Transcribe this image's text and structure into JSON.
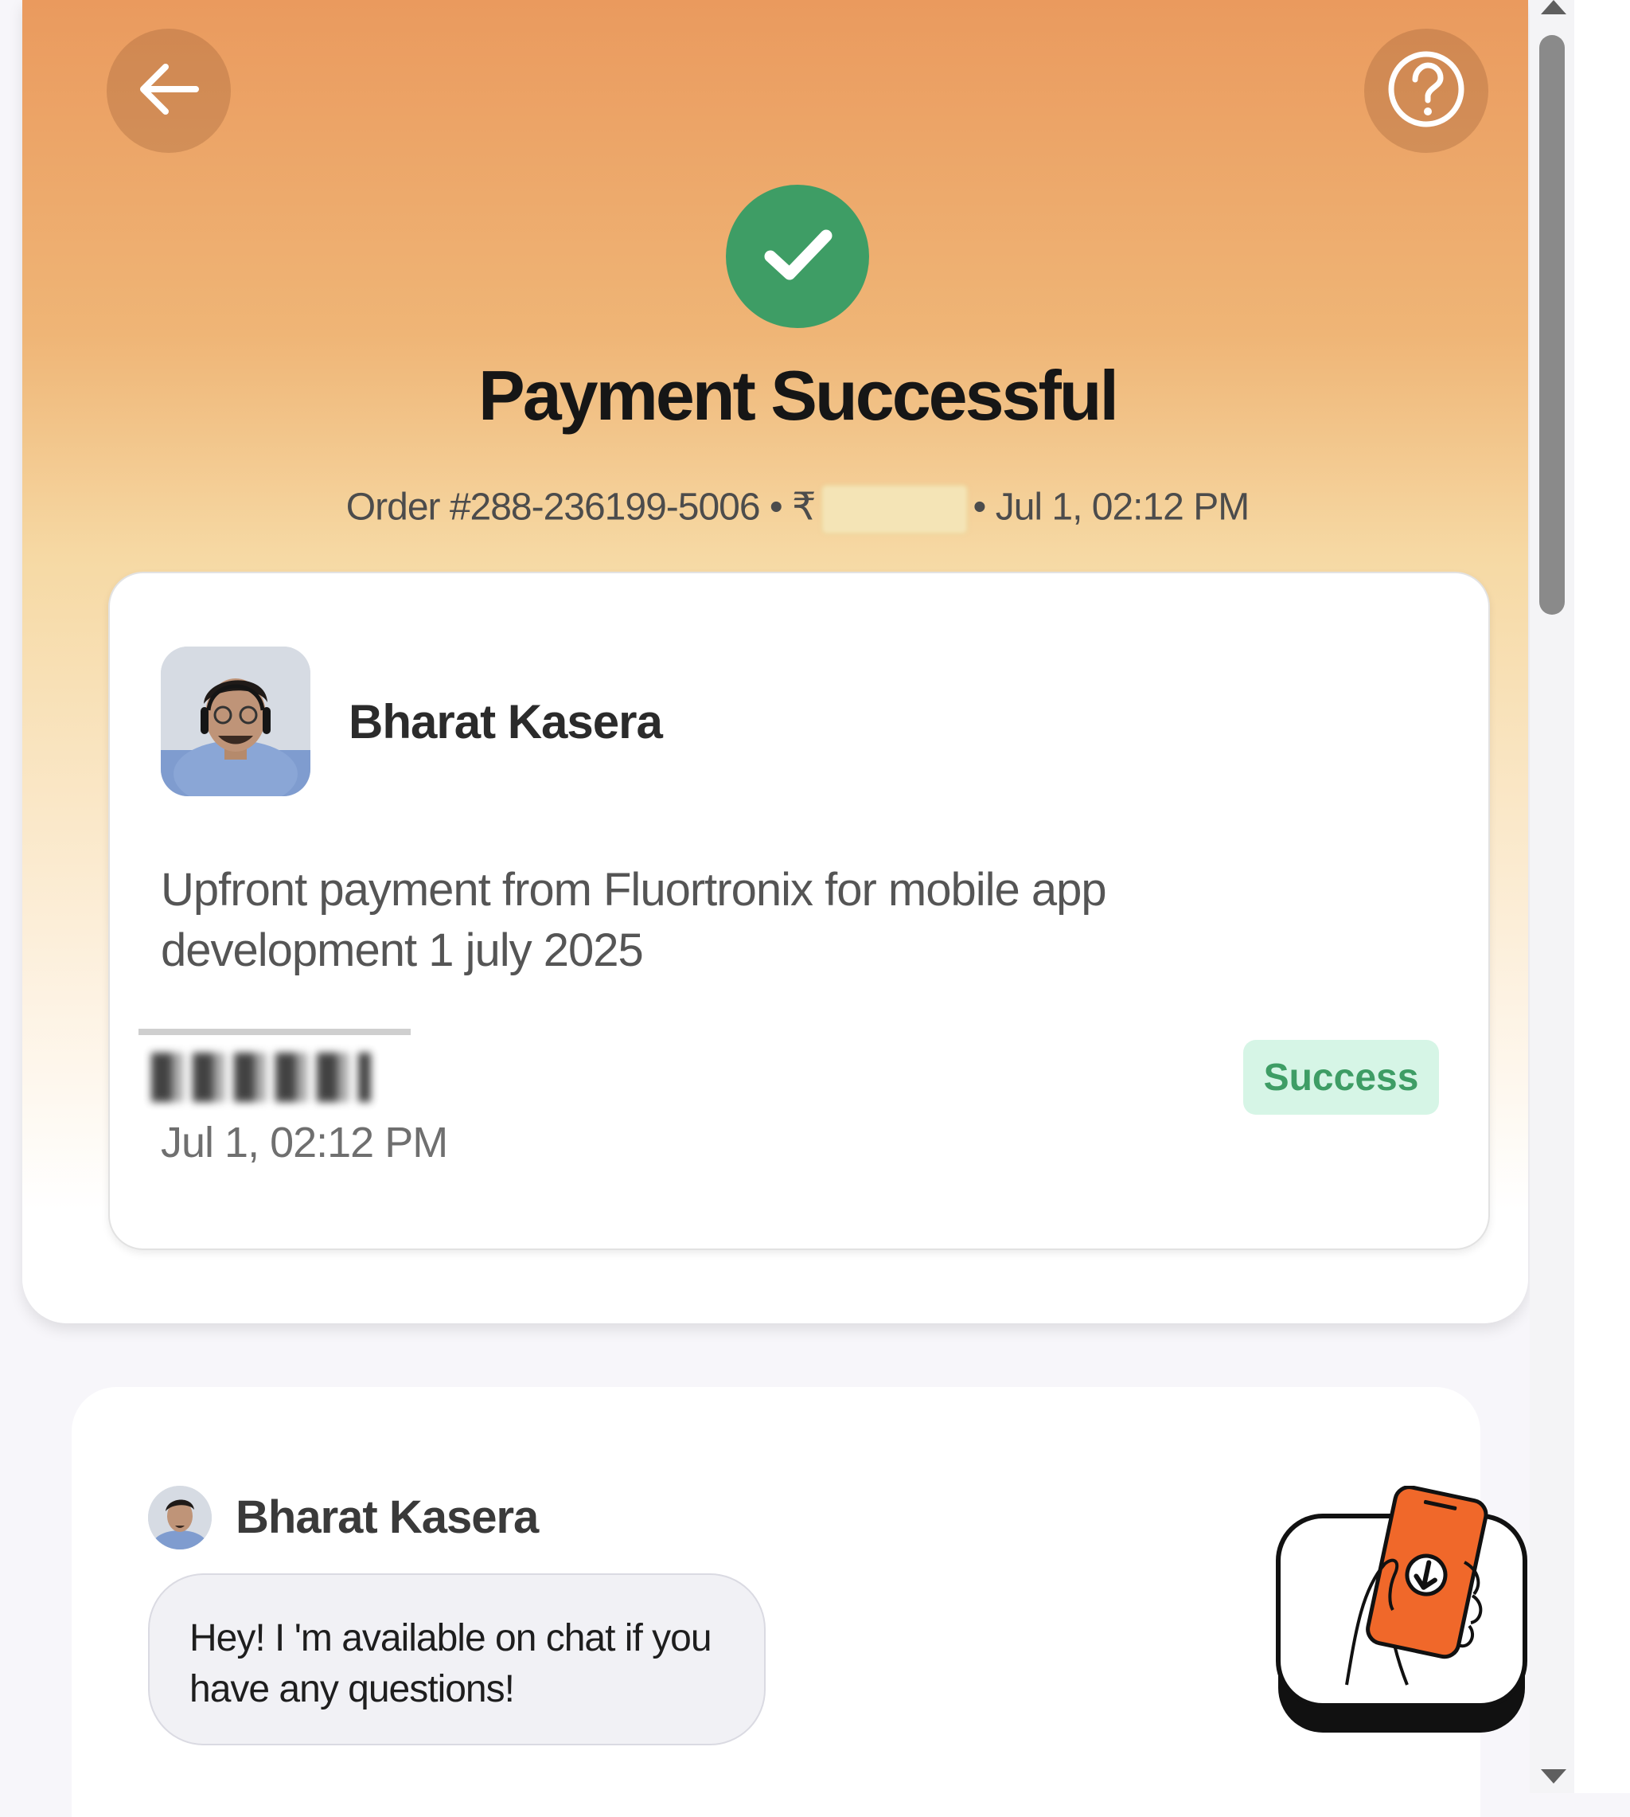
{
  "header": {
    "title": "Payment Successful",
    "order_text": "Order #288-236199-5006 • ₹",
    "order_time": "• Jul 1, 02:12 PM"
  },
  "icons": {
    "back": "arrow-left-icon",
    "help": "help-circle-icon",
    "success": "check-icon",
    "download": "phone-download-icon"
  },
  "payment": {
    "payee_name": "Bharat Kasera",
    "description": "Upfront payment from Fluortronix for mobile app development 1 july 2025",
    "time": "Jul 1, 02:12 PM",
    "status": "Success"
  },
  "chat": {
    "name": "Bharat Kasera",
    "message": "Hey! I 'm available on chat if you have any questions!"
  },
  "colors": {
    "hero_top": "#ea9a5e",
    "success_green": "#3e9d65",
    "status_bg": "#d6f5e6",
    "download_orange": "#f0682a"
  }
}
